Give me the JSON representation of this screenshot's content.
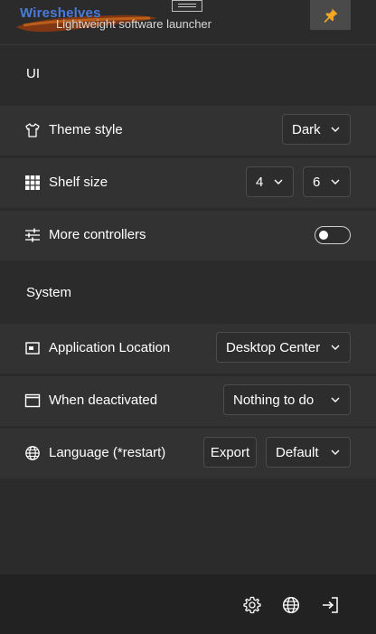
{
  "header": {
    "app_name": "Wireshelves",
    "subtitle": "Lightweight software launcher",
    "pin_icon": "pin-icon"
  },
  "sections": {
    "ui": {
      "title": "UI",
      "theme": {
        "label": "Theme style",
        "icon": "shirt-icon",
        "value": "Dark"
      },
      "shelf": {
        "label": "Shelf size",
        "icon": "grid-icon",
        "cols": "4",
        "rows": "6"
      },
      "more": {
        "label": "More controllers",
        "icon": "sliders-icon",
        "enabled": false
      }
    },
    "system": {
      "title": "System",
      "location": {
        "label": "Application Location",
        "icon": "window-pos-icon",
        "value": "Desktop Center"
      },
      "deactivated": {
        "label": "When deactivated",
        "icon": "window-icon",
        "value": "Nothing to do"
      },
      "language": {
        "label": "Language (*restart)",
        "icon": "globe-icon",
        "export_label": "Export",
        "value": "Default"
      }
    }
  },
  "footer": {
    "icons": [
      "settings-icon",
      "globe-icon",
      "exit-icon"
    ]
  },
  "colors": {
    "accent_pin": "#f5a623",
    "brand_blue": "#4a7bd9",
    "background": "#2b2b2b",
    "row_background": "#323232"
  }
}
